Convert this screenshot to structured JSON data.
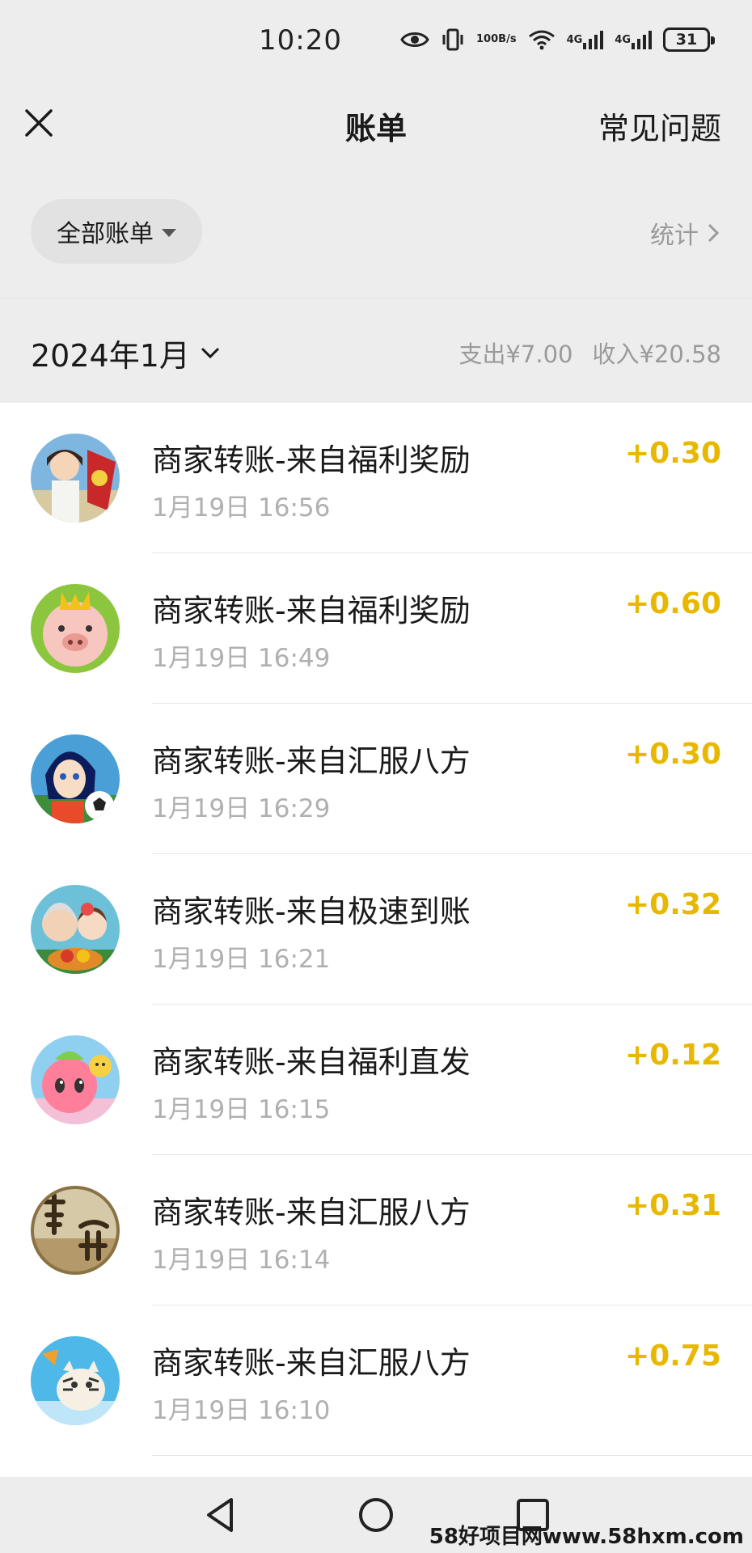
{
  "status_bar": {
    "time": "10:20",
    "speed_value": "100",
    "speed_unit": "B/s",
    "net1": "4G",
    "net2": "4G",
    "battery": "31"
  },
  "nav": {
    "title": "账单",
    "faq": "常见问题"
  },
  "filter": {
    "label": "全部账单",
    "stats": "统计"
  },
  "month": {
    "label": "2024年1月",
    "expense": "支出¥7.00",
    "income": "收入¥20.58"
  },
  "transactions": [
    {
      "title": "商家转账-来自福利奖励",
      "time": "1月19日 16:56",
      "amount": "+0.30",
      "avatar": "game-girl-flag"
    },
    {
      "title": "商家转账-来自福利奖励",
      "time": "1月19日 16:49",
      "amount": "+0.60",
      "avatar": "pig-king"
    },
    {
      "title": "商家转账-来自汇服八方",
      "time": "1月19日 16:29",
      "amount": "+0.30",
      "avatar": "soccer-girl"
    },
    {
      "title": "商家转账-来自极速到账",
      "time": "1月19日 16:21",
      "amount": "+0.32",
      "avatar": "grandma-girl"
    },
    {
      "title": "商家转账-来自福利直发",
      "time": "1月19日 16:15",
      "amount": "+0.12",
      "avatar": "cute-blob"
    },
    {
      "title": "商家转账-来自汇服八方",
      "time": "1月19日 16:14",
      "amount": "+0.31",
      "avatar": "calligraphy-art"
    },
    {
      "title": "商家转账-来自汇服八方",
      "time": "1月19日 16:10",
      "amount": "+0.75",
      "avatar": "tiger-cartoon"
    }
  ],
  "watermark": "58好项目网www.58hxm.com",
  "colors": {
    "background": "#ededed",
    "list_bg": "#ffffff",
    "amount": "#e8b800",
    "muted": "#9a9a9a"
  }
}
